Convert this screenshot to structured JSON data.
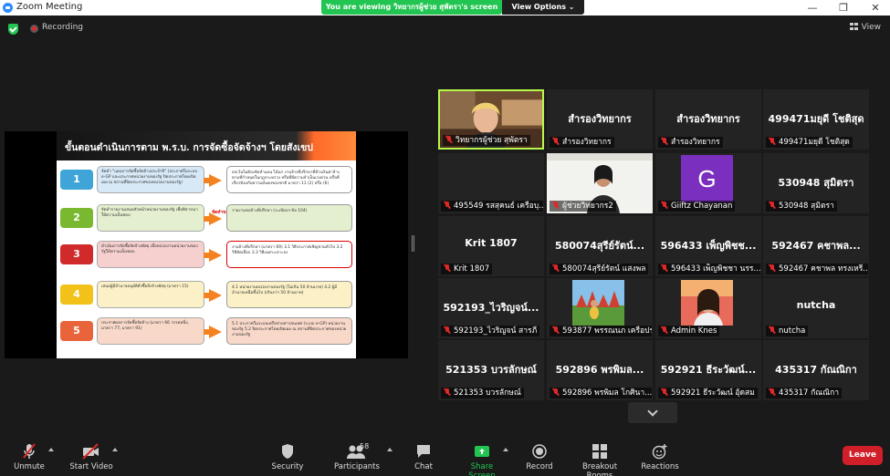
{
  "window": {
    "title": "Zoom Meeting",
    "min_icon": "minimize-icon",
    "max_icon": "maximize-icon",
    "close_icon": "close-icon"
  },
  "share_banner": {
    "text": "You are viewing วิทยากรผู้ช่วย สุพัตรา's screen",
    "view_options": "View Options ⌄"
  },
  "topbar": {
    "recording": "Recording",
    "view": "View"
  },
  "slide": {
    "title": "ขั้นตอนดำเนินการตาม พ.ร.บ. การจัดซื้อจัดจ้างฯ โดยสังเขป",
    "red_note": "จัดทำขอบเขตของงาน + ราคากลางงาน",
    "steps": [
      {
        "num": "1",
        "color": "#3fa5d8",
        "text": "จัดทำ \"แผนการจัดซื้อจัดจ้างประจำปี\" (ประกาศในระบบ e-GP และประกาศหน่วยงานของรัฐ ปิดประกาศโดยเปิดเผย ณ สถานที่ปิดประกาศของหน่วยงานของรัฐ)",
        "result": "ยกเว้นไม่ต้องจัดทำแผน ได้แก่ งานจ้างที่ปรึกษาที่มีวงเงินค่าจ้างตามที่กำหนดในกฎกระทรวง หรือที่มีความจำเป็นเร่งด่วน หรือที่เกี่ยวข้องกับความมั่นคงของชาติ มาตรา 11 (2) หรือ (6)",
        "box_bg": "#d7e8f6",
        "res_bg": "#ffffff"
      },
      {
        "num": "2",
        "color": "#7ab830",
        "text": "จัดทำรายงานเสนอหัวหน้าหน่วยงานของรัฐ เพื่อพิจารณาให้ความเห็นชอบ",
        "result": "รายงานขอจ้างที่ปรึกษา (ระเบียบฯ ข้อ 104)",
        "box_bg": "#e4efcf",
        "res_bg": "#e4efcf"
      },
      {
        "num": "3",
        "color": "#d12a2a",
        "text": "ดำเนินการจัดซื้อจัดจ้างพัสดุ เมื่อหน่วยงานหน่วยงานของรัฐให้ความเห็นชอบ",
        "result": "งานจ้างที่ปรึกษา (มาตรา 69) 3.1 วิธีประกาศเชิญชวนทั่วไป 3.2 วิธีคัดเลือก 3.3 วิธีเฉพาะเจาะจง",
        "box_bg": "#f6cfcf",
        "res_bg": "#ffffff"
      },
      {
        "num": "4",
        "color": "#f2c21b",
        "text": "เสนอผู้มีอำนาจอนุมัติสั่งซื้อสั่งจ้างพัสดุ (มาตรา 15)",
        "result": "4.1 หน่วยงานหน่วยงานของรัฐ (ไม่เกิน 50 ล้านบาท) 4.2 ผู้มีอำนาจเหนือขึ้นไป (เกินกว่า 50 ล้านบาท)",
        "box_bg": "#fbf0c6",
        "res_bg": "#fbf0c6"
      },
      {
        "num": "5",
        "color": "#e9643b",
        "text": "ประกาศผลการจัดซื้อจัดจ้าง (มาตรา 66 วรรคหนึ่ง, มาตรา 77, มาตรา 91)",
        "result": "5.1 ประกาศในระบบเครือข่ายสารสนเทศ (ระบบ e-GP) หน่วยงานของรัฐ 5.2 ปิดประกาศโดยเปิดเผย ณ สถานที่ปิดประกาศของหน่วยงานของรัฐ",
        "box_bg": "#f8d8c8",
        "res_bg": "#f8d8c8"
      }
    ]
  },
  "gallery": [
    {
      "center": "",
      "label": "วิทยากรผู้ช่วย สุพัตรา",
      "type": "video",
      "active": true
    },
    {
      "center": "สำรองวิทยากร",
      "label": "สำรองวิทยากร",
      "type": "text"
    },
    {
      "center": "สำรองวิทยากร",
      "label": "สำรองวิทยากร",
      "type": "text"
    },
    {
      "center": "499471มยุดี โชติสุด",
      "label": "499471มยุดี โชติสุด",
      "type": "text"
    },
    {
      "center": "",
      "label": "495549 รสสุคนธ์ เครือบุ...",
      "type": "dark"
    },
    {
      "center": "",
      "label": "ผู้ช่วยวิทยากร2",
      "type": "video2"
    },
    {
      "center": "",
      "label": "Giiftz Chayanan",
      "type": "avatar",
      "initial": "G"
    },
    {
      "center": "530948 สุมิตรา",
      "label": "530948 สุมิตรา",
      "type": "text"
    },
    {
      "center": "Krit 1807",
      "label": "Krit 1807",
      "type": "text"
    },
    {
      "center": "580074สุรีย์รัตน์...",
      "label": "580074สุรีย์รัตน์ แสงพล",
      "type": "text"
    },
    {
      "center": "596433 เพ็ญพิชช...",
      "label": "596433 เพ็ญพิชชา นรร...",
      "type": "text"
    },
    {
      "center": "592467 คชาพล...",
      "label": "592467 คชาพล ทรงเหรี...",
      "type": "text"
    },
    {
      "center": "592193_ไวริญจน์...",
      "label": "592193_ไวริญจน์ สารภี",
      "type": "text"
    },
    {
      "center": "",
      "label": "593877 พรรณนภ เครือประ...",
      "type": "photo"
    },
    {
      "center": "",
      "label": "Admin Knes",
      "type": "photo2"
    },
    {
      "center": "nutcha",
      "label": "nutcha",
      "type": "text"
    },
    {
      "center": "521353 บวรลักษณ์",
      "label": "521353 บวรลักษณ์",
      "type": "text"
    },
    {
      "center": "592896 พรพิมล...",
      "label": "592896 พรพิมล โกศินา...",
      "type": "text"
    },
    {
      "center": "592921 ธีระวัฒน์...",
      "label": "592921 ธีระวัฒน์ อุ้ดสม",
      "type": "text"
    },
    {
      "center": "435317 กัณณิกา",
      "label": "435317 กัณณิกา",
      "type": "text"
    }
  ],
  "toolbar": {
    "unmute": "Unmute",
    "start_video": "Start Video",
    "security": "Security",
    "participants": "Participants",
    "participants_count": "58",
    "chat": "Chat",
    "share_screen": "Share Screen",
    "record": "Record",
    "breakout_rooms": "Breakout Rooms",
    "reactions": "Reactions",
    "leave": "Leave"
  }
}
